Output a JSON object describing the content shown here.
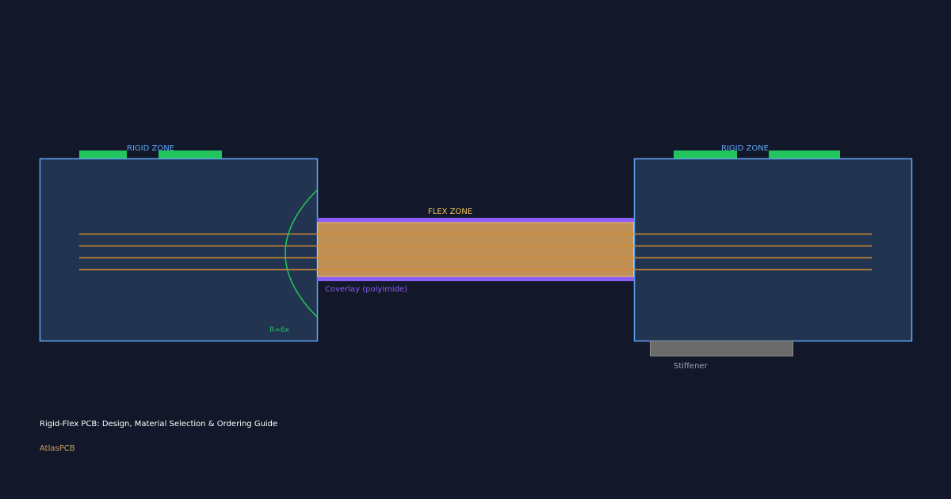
{
  "diagram": {
    "left_zone_label": "RIGID ZONE",
    "right_zone_label": "RIGID ZONE",
    "flex_zone_label": "FLEX ZONE",
    "coverlay_label": "Coverlay (polyimide)",
    "bend_radius_label": "R=6x",
    "stiffener_label": "Stiffener"
  },
  "footer": {
    "title": "Rigid-Flex PCB: Design, Material Selection & Ordering Guide",
    "brand": "AtlasPCB"
  },
  "colors": {
    "background": "#121829",
    "rigid_fill": "#22344f",
    "rigid_stroke": "#60a5fa",
    "pad": "#22c55e",
    "trace": "#d08a34",
    "flex_fill": "#c08f54",
    "flex_stroke": "#f3c35d",
    "coverlay": "#8b5cf6",
    "bend_arc": "#22c55e",
    "stiffener": "#6b6b6b",
    "zone_label": "#60a5fa",
    "flex_label": "#f3c35d"
  }
}
